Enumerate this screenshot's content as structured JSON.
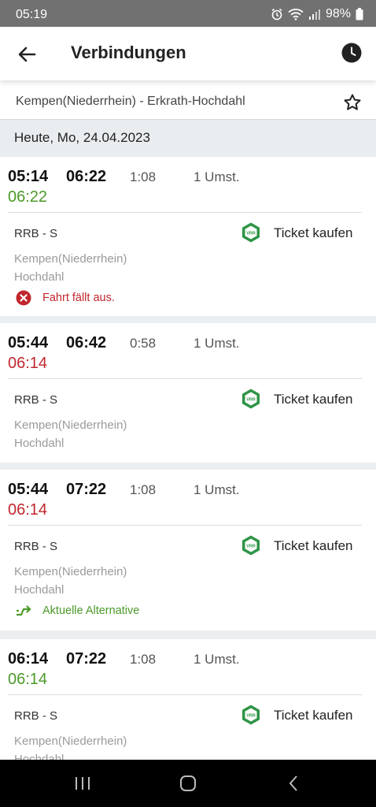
{
  "status_bar": {
    "time": "05:19",
    "battery": "98%",
    "icons": [
      "alarm-icon",
      "wifi-icon",
      "signal-icon",
      "battery-icon"
    ]
  },
  "app_bar": {
    "title": "Verbindungen",
    "back_icon": "arrow-left-icon",
    "history_icon": "clock-icon"
  },
  "route": {
    "text": "Kempen(Niederrhein) - Erkrath-Hochdahl",
    "favorite_icon": "star-outline-icon"
  },
  "date_header": "Heute, Mo, 24.04.2023",
  "colors": {
    "on_time": "#4c9a2a",
    "delayed": "#c0272d",
    "vrr_green": "#2e9447"
  },
  "connections": [
    {
      "departure": "05:14",
      "arrival": "06:22",
      "duration": "1:08",
      "changes": "1 Umst.",
      "actual_departure": "06:22",
      "actual_status": "on-time",
      "product": "RRB - S",
      "ticket_label": "Ticket kaufen",
      "from_stop": "Kempen(Niederrhein)",
      "to_stop": "Hochdahl",
      "note": "Fahrt fällt aus.",
      "note_type": "cancelled"
    },
    {
      "departure": "05:44",
      "arrival": "06:42",
      "duration": "0:58",
      "changes": "1 Umst.",
      "actual_departure": "06:14",
      "actual_status": "delayed",
      "product": "RRB - S",
      "ticket_label": "Ticket kaufen",
      "from_stop": "Kempen(Niederrhein)",
      "to_stop": "Hochdahl"
    },
    {
      "departure": "05:44",
      "arrival": "07:22",
      "duration": "1:08",
      "changes": "1 Umst.",
      "actual_departure": "06:14",
      "actual_status": "delayed",
      "product": "RRB - S",
      "ticket_label": "Ticket kaufen",
      "from_stop": "Kempen(Niederrhein)",
      "to_stop": "Hochdahl",
      "note": "Aktuelle Alternative",
      "note_type": "alternative"
    },
    {
      "departure": "06:14",
      "arrival": "07:22",
      "duration": "1:08",
      "changes": "1 Umst.",
      "actual_departure": "06:14",
      "actual_status": "on-time",
      "product": "RRB - S",
      "ticket_label": "Ticket kaufen",
      "from_stop": "Kempen(Niederrhein)",
      "to_stop": "Hochdahl"
    }
  ],
  "nav_bar": {
    "buttons": [
      "recent-apps-icon",
      "home-icon",
      "back-icon"
    ]
  }
}
